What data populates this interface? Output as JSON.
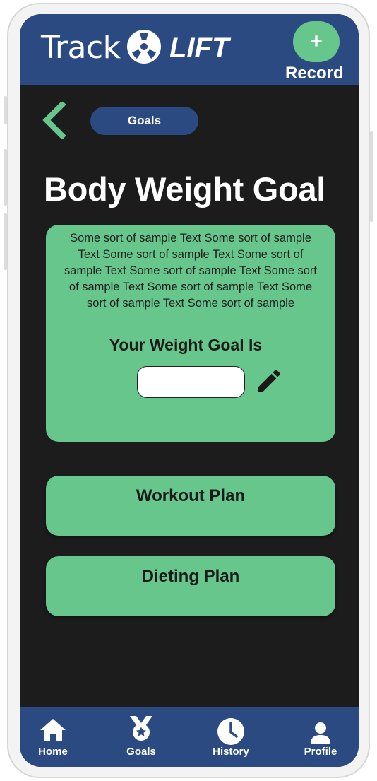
{
  "header": {
    "logo_text_regular": "Track",
    "logo_text_bold": "LIFT",
    "record_icon": "+",
    "record_label": "Record"
  },
  "nav_top": {
    "back_icon": "chevron-left-icon",
    "goals_pill_label": "Goals"
  },
  "page": {
    "title": "Body Weight Goal"
  },
  "goal_card": {
    "sample_text": "Some sort of sample Text Some sort of sample Text Some sort of sample Text Some sort of sample Text Some sort of sample Text Some sort of sample Text Some sort of sample Text Some sort of sample Text Some sort of sample",
    "heading": "Your Weight Goal Is",
    "input_value": "",
    "edit_icon": "pencil-icon"
  },
  "plans": {
    "workout_label": "Workout Plan",
    "dieting_label": "Dieting Plan"
  },
  "bottom_nav": {
    "items": [
      {
        "label": "Home",
        "icon": "home-icon"
      },
      {
        "label": "Goals",
        "icon": "medal-icon"
      },
      {
        "label": "History",
        "icon": "clock-icon"
      },
      {
        "label": "Profile",
        "icon": "user-icon"
      }
    ]
  },
  "colors": {
    "brand_blue": "#2c4a82",
    "accent_green": "#67c68b",
    "background": "#1c1c1c"
  }
}
